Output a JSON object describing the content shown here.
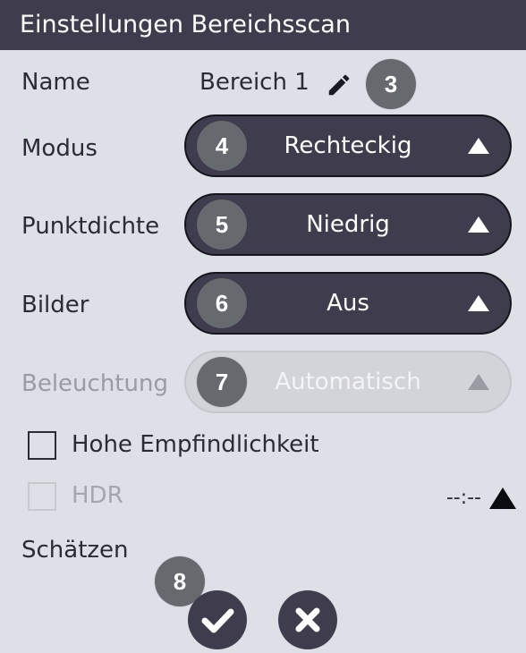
{
  "header": {
    "title": "Einstellungen Bereichsscan"
  },
  "name": {
    "label": "Name",
    "value": "Bereich 1",
    "icon": "pencil-icon"
  },
  "fields": [
    {
      "label": "Modus",
      "badge": "4",
      "value": "Rechteckig",
      "enabled": true
    },
    {
      "label": "Punktdichte",
      "badge": "5",
      "value": "Niedrig",
      "enabled": true
    },
    {
      "label": "Bilder",
      "badge": "6",
      "value": "Aus",
      "enabled": true
    },
    {
      "label": "Beleuchtung",
      "badge": "7",
      "value": "Automatisch",
      "enabled": false
    }
  ],
  "checkboxes": [
    {
      "label": "Hohe Empfindlichkeit",
      "checked": false,
      "enabled": true
    },
    {
      "label": "HDR",
      "checked": false,
      "enabled": false
    }
  ],
  "estimate": {
    "label": "Schätzen",
    "value": "--:--"
  },
  "callouts": {
    "name": "3",
    "footer": "8"
  },
  "footer": {
    "confirm_icon": "checkmark-icon",
    "cancel_icon": "close-icon"
  },
  "colors": {
    "header_bg": "#3f3d4d",
    "panel_bg": "#dee0e7",
    "badge_bg": "#666a6f",
    "disabled_bg": "#d2d4da"
  }
}
